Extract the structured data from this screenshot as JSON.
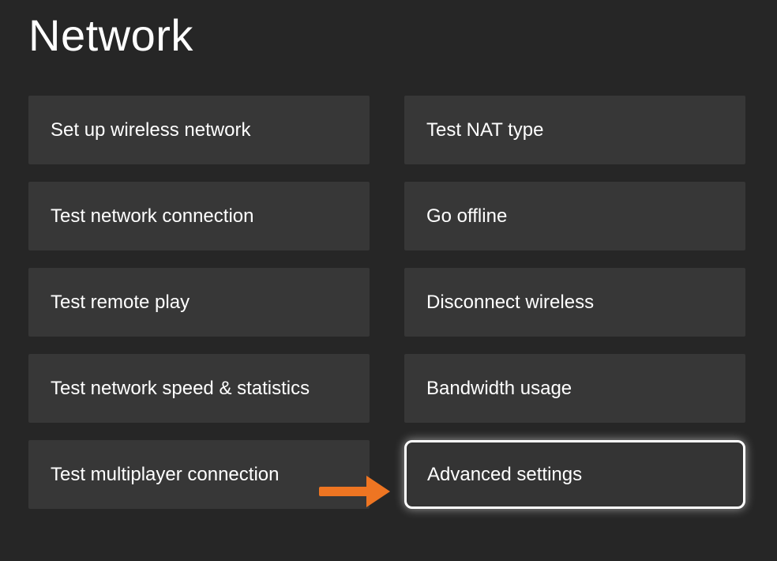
{
  "title": "Network",
  "leftColumn": [
    {
      "label": "Set up wireless network",
      "name": "set-up-wireless-network-button"
    },
    {
      "label": "Test network connection",
      "name": "test-network-connection-button"
    },
    {
      "label": "Test remote play",
      "name": "test-remote-play-button"
    },
    {
      "label": "Test network speed & statistics",
      "name": "test-network-speed-statistics-button"
    },
    {
      "label": "Test multiplayer connection",
      "name": "test-multiplayer-connection-button"
    }
  ],
  "rightColumn": [
    {
      "label": "Test NAT type",
      "name": "test-nat-type-button",
      "selected": false
    },
    {
      "label": "Go offline",
      "name": "go-offline-button",
      "selected": false
    },
    {
      "label": "Disconnect wireless",
      "name": "disconnect-wireless-button",
      "selected": false
    },
    {
      "label": "Bandwidth usage",
      "name": "bandwidth-usage-button",
      "selected": false
    },
    {
      "label": "Advanced settings",
      "name": "advanced-settings-button",
      "selected": true
    }
  ],
  "annotationArrowColor": "#ee7522"
}
